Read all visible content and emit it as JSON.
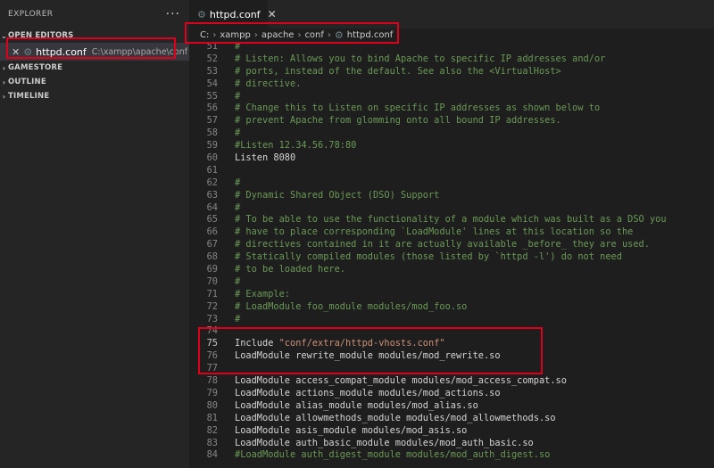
{
  "sidebar": {
    "title": "EXPLORER",
    "more_icon": "ellipsis-icon",
    "open_editors_label": "OPEN EDITORS",
    "open_editor": {
      "close": "✕",
      "name": "httpd.conf",
      "path": "C:\\xampp\\apache\\conf"
    },
    "sections": [
      "GAMESTORE",
      "OUTLINE",
      "TIMELINE"
    ]
  },
  "tab": {
    "label": "httpd.conf",
    "close": "✕"
  },
  "breadcrumbs": [
    "C:",
    "xampp",
    "apache",
    "conf",
    "httpd.conf"
  ],
  "lines": [
    {
      "n": "51",
      "segs": [
        {
          "t": "#",
          "c": "comment"
        }
      ]
    },
    {
      "n": "52",
      "segs": [
        {
          "t": "# Listen: Allows you to bind Apache to specific IP addresses and/or",
          "c": "comment"
        }
      ]
    },
    {
      "n": "53",
      "segs": [
        {
          "t": "# ports, instead of the default. See also the <VirtualHost>",
          "c": "comment"
        }
      ]
    },
    {
      "n": "54",
      "segs": [
        {
          "t": "# directive.",
          "c": "comment"
        }
      ]
    },
    {
      "n": "55",
      "segs": [
        {
          "t": "#",
          "c": "comment"
        }
      ]
    },
    {
      "n": "56",
      "segs": [
        {
          "t": "# Change this to Listen on specific IP addresses as shown below to",
          "c": "comment"
        }
      ]
    },
    {
      "n": "57",
      "segs": [
        {
          "t": "# prevent Apache from glomming onto all bound IP addresses.",
          "c": "comment"
        }
      ]
    },
    {
      "n": "58",
      "segs": [
        {
          "t": "#",
          "c": "comment"
        }
      ]
    },
    {
      "n": "59",
      "segs": [
        {
          "t": "#Listen 12.34.56.78:80",
          "c": "comment"
        }
      ]
    },
    {
      "n": "60",
      "segs": [
        {
          "t": "Listen 8080",
          "c": "plain"
        }
      ]
    },
    {
      "n": "61",
      "segs": []
    },
    {
      "n": "62",
      "segs": [
        {
          "t": "#",
          "c": "comment"
        }
      ]
    },
    {
      "n": "63",
      "segs": [
        {
          "t": "# Dynamic Shared Object (DSO) Support",
          "c": "comment"
        }
      ]
    },
    {
      "n": "64",
      "segs": [
        {
          "t": "#",
          "c": "comment"
        }
      ]
    },
    {
      "n": "65",
      "segs": [
        {
          "t": "# To be able to use the functionality of a module which was built as a DSO you",
          "c": "comment"
        }
      ]
    },
    {
      "n": "66",
      "segs": [
        {
          "t": "# have to place corresponding `LoadModule' lines at this location so the",
          "c": "comment"
        }
      ]
    },
    {
      "n": "67",
      "segs": [
        {
          "t": "# directives contained in it are actually available _before_ they are used.",
          "c": "comment"
        }
      ]
    },
    {
      "n": "68",
      "segs": [
        {
          "t": "# Statically compiled modules (those listed by `httpd -l') do not need",
          "c": "comment"
        }
      ]
    },
    {
      "n": "69",
      "segs": [
        {
          "t": "# to be loaded here.",
          "c": "comment"
        }
      ]
    },
    {
      "n": "70",
      "segs": [
        {
          "t": "#",
          "c": "comment"
        }
      ]
    },
    {
      "n": "71",
      "segs": [
        {
          "t": "# Example:",
          "c": "comment"
        }
      ]
    },
    {
      "n": "72",
      "segs": [
        {
          "t": "# LoadModule foo_module modules/mod_foo.so",
          "c": "comment"
        }
      ]
    },
    {
      "n": "73",
      "segs": [
        {
          "t": "#",
          "c": "comment"
        }
      ]
    },
    {
      "n": "74",
      "segs": []
    },
    {
      "n": "75",
      "active": true,
      "segs": [
        {
          "t": "Include ",
          "c": "plain"
        },
        {
          "t": "\"conf/extra/httpd-vhosts.conf\"",
          "c": "str"
        }
      ]
    },
    {
      "n": "76",
      "segs": [
        {
          "t": "LoadModule rewrite_module modules/mod_rewrite.so",
          "c": "plain"
        }
      ]
    },
    {
      "n": "77",
      "segs": []
    },
    {
      "n": "78",
      "segs": [
        {
          "t": "LoadModule access_compat_module modules/mod_access_compat.so",
          "c": "plain"
        }
      ]
    },
    {
      "n": "79",
      "segs": [
        {
          "t": "LoadModule actions_module modules/mod_actions.so",
          "c": "plain"
        }
      ]
    },
    {
      "n": "80",
      "segs": [
        {
          "t": "LoadModule alias_module modules/mod_alias.so",
          "c": "plain"
        }
      ]
    },
    {
      "n": "81",
      "segs": [
        {
          "t": "LoadModule allowmethods_module modules/mod_allowmethods.so",
          "c": "plain"
        }
      ]
    },
    {
      "n": "82",
      "segs": [
        {
          "t": "LoadModule asis_module modules/mod_asis.so",
          "c": "plain"
        }
      ]
    },
    {
      "n": "83",
      "segs": [
        {
          "t": "LoadModule auth_basic_module modules/mod_auth_basic.so",
          "c": "plain"
        }
      ]
    },
    {
      "n": "84",
      "segs": [
        {
          "t": "#LoadModule auth_digest_module modules/mod_auth_digest.so",
          "c": "comment"
        }
      ]
    }
  ],
  "colors": {
    "annotation_box": "#e0001b",
    "comment": "#6a9955",
    "string": "#ce9178",
    "text": "#d4d4d4",
    "gear_icon": "#6d8086"
  }
}
